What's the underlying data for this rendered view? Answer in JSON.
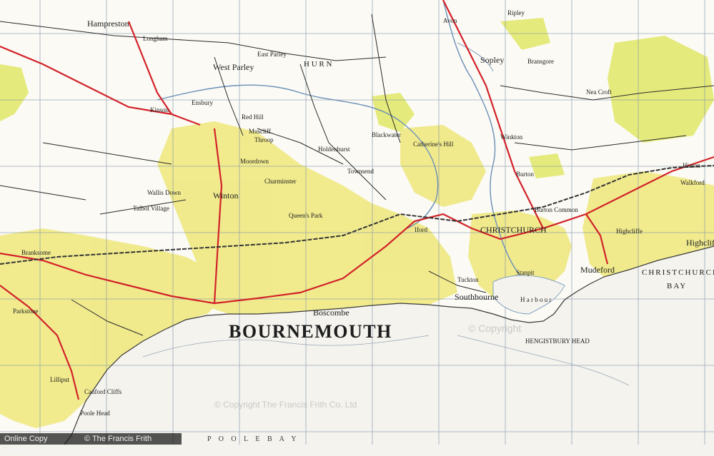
{
  "map": {
    "town_title": "BOURNEMOUTH",
    "sea_name": "CHRISTCHURCH",
    "bay_name": "BAY",
    "bottom_text": "P O O L E   B A Y",
    "places": {
      "hampreston": "Hampreston",
      "longham": "Longham",
      "west_parley": "West Parley",
      "east_parley": "East Parley",
      "hurn": "H U R N",
      "sopley": "Sopley",
      "ripley": "Ripley",
      "avon": "Avon",
      "ensbury": "Ensbury",
      "kinson": "Kinson",
      "throop": "Throop",
      "holdenhurst": "Holdenhurst",
      "winton": "Winton",
      "talbot_village": "Talbot Village",
      "moordown": "Moordown",
      "charminster": "Charminster",
      "queens_park": "Queen's Park",
      "boscombe": "Boscombe",
      "southbourne": "Southbourne",
      "christchurch": "CHRISTCHURCH",
      "mudeford": "Mudeford",
      "highcliffe": "Highclif",
      "burton": "Burton",
      "winkton": "Winkton",
      "hinton": "Hinton",
      "branksome": "Branksome",
      "parkstone": "Parkstone",
      "poole_head": "Poole Head",
      "hengistbury_head": "HENGISTBURY HEAD",
      "tuckton": "Tuckton",
      "iford": "Iford",
      "blackwater": "Blackwater",
      "walkford": "Walkford",
      "bransgore": "Bransgore",
      "neacroft": "Nea Croft",
      "stanpit": "Stanpit",
      "highcliffe_right": "Highcliffe",
      "canford_cliffs": "Canford Cliffs",
      "lilliput": "Lilliput",
      "harbour": "H a r b o u r",
      "st_catherines_hill": "Catherine's Hill",
      "townsend": "Townsend",
      "wallisdown": "Wallis Down",
      "muscliff": "Muscliff",
      "redhill": "Red Hill",
      "burton_common": "Burton Common"
    }
  },
  "watermarks": {
    "mark1": "© Copyright The Francis Frith Co. Ltd",
    "mark2": "© Copyright"
  },
  "footer": {
    "left": "Online Copy Reduction",
    "right": "© The Francis Frith Collection"
  },
  "colors": {
    "sea": "#f4f3ee",
    "land": "#f7f7f2",
    "urban": "#f1ec8a",
    "grid": "#7b8fa8",
    "road_major": "#d2222a",
    "road_minor": "#2a2a2a",
    "river": "#6b8fb8",
    "woodland": "#e3e889"
  }
}
